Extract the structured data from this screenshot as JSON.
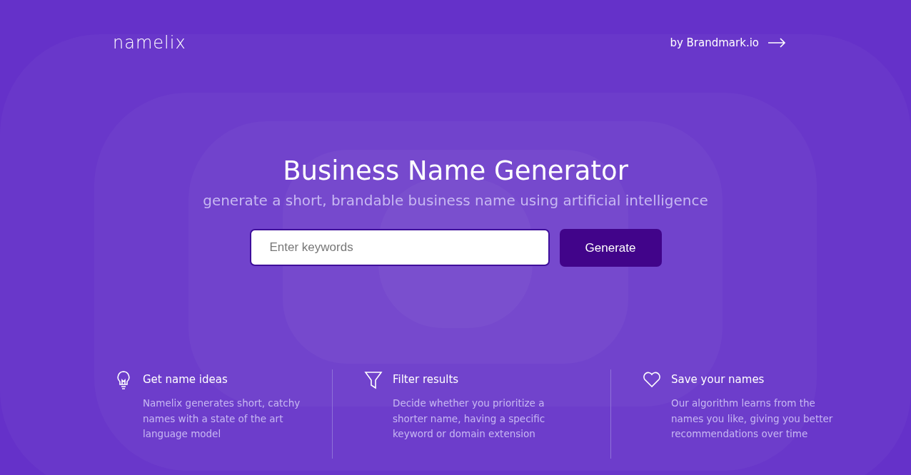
{
  "header": {
    "logo": "namelix",
    "link": "by Brandmark.io"
  },
  "hero": {
    "title": "Business Name Generator",
    "subtitle": "generate a short, brandable business name using artificial intelligence",
    "search": {
      "placeholder": "Enter keywords"
    },
    "button": "Generate"
  },
  "features": [
    {
      "kind": "bulb",
      "title": "Get name ideas",
      "text": "Namelix generates short, catchy names with a state of the art language model"
    },
    {
      "kind": "filter",
      "title": "Filter results",
      "text": "Decide whether you prioritize a shorter name, having a specific keyword or domain extension"
    },
    {
      "kind": "heart",
      "title": "Save your names",
      "text": "Our algorithm learns from the names you like, giving you better recommendations over time"
    }
  ]
}
